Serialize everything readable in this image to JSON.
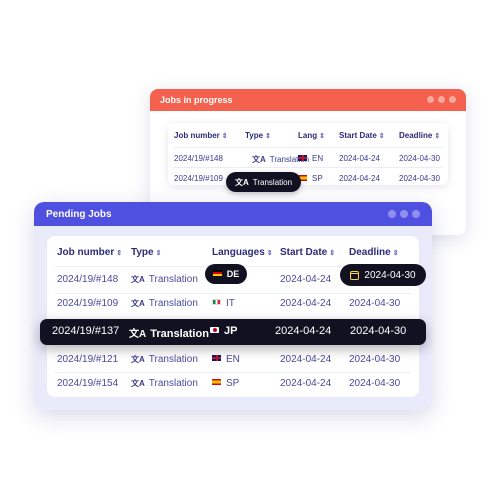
{
  "jobs_in_progress": {
    "title": "Jobs in progress",
    "columns": [
      "Job number",
      "Type",
      "Lang",
      "Start Date",
      "Deadline"
    ],
    "sort_icon": "⇕",
    "rows": [
      {
        "job": "2024/19/#148",
        "type": "Translation",
        "lang": "EN",
        "flag": "uk",
        "start": "2024-04-24",
        "deadline": "2024-04-30"
      },
      {
        "job": "2024/19/#109",
        "type": "Translation",
        "lang": "SP",
        "flag": "sp",
        "start": "2024-04-24",
        "deadline": "2024-04-30"
      }
    ],
    "tooltip": "Translation"
  },
  "pending_jobs": {
    "title": "Pending Jobs",
    "columns": [
      "Job number",
      "Type",
      "Languages",
      "Start Date",
      "Deadline"
    ],
    "sort_icon": "⇕",
    "rows": [
      {
        "job": "2024/19/#148",
        "type": "Translation",
        "lang": "DE",
        "flag": "de",
        "start": "2024-04-24",
        "deadline": "2024-04-30"
      },
      {
        "job": "2024/19/#109",
        "type": "Translation",
        "lang": "IT",
        "flag": "it",
        "start": "2024-04-24",
        "deadline": "2024-04-30"
      },
      {
        "job": "2024/19/#137",
        "type": "Translation",
        "lang": "JP",
        "flag": "jp",
        "start": "2024-04-24",
        "deadline": "2024-04-30"
      },
      {
        "job": "2024/19/#121",
        "type": "Translation",
        "lang": "EN",
        "flag": "uk",
        "start": "2024-04-24",
        "deadline": "2024-04-30"
      },
      {
        "job": "2024/19/#154",
        "type": "Translation",
        "lang": "SP",
        "flag": "sp",
        "start": "2024-04-24",
        "deadline": "2024-04-30"
      }
    ]
  },
  "icons": {
    "translation": "translate-icon",
    "calendar": "calendar-icon"
  },
  "colors": {
    "back_titlebar": "#f4624f",
    "front_titlebar": "#4f4fe0",
    "highlight": "#111122",
    "text": "#2b2b7a"
  }
}
